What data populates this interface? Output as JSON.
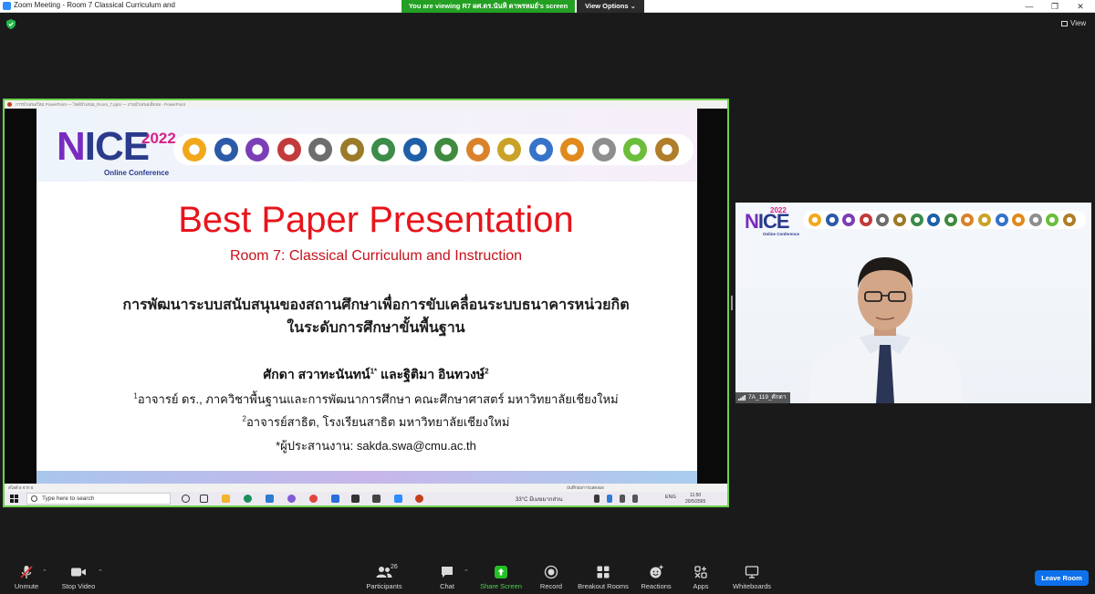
{
  "window": {
    "title": "Zoom Meeting - Room 7 Classical Curriculum and",
    "viewing_banner": "You are viewing R7 ผศ.ดร.นันทิ ตาพรหมย์'s screen",
    "view_options": "View Options ⌄",
    "view_label": "View",
    "minimize": "—",
    "restore": "❐",
    "close": "✕"
  },
  "ppt": {
    "title_bar": "การนำเสนอใหม่ PowerPoint  —  ไฟล์นำเสนอ_Room_7.pptx  —  งานนำเสนอเต็มจอ - PowerPoint",
    "status": "สไลด์ 6 จาก 6",
    "status_right": "บันทึกย่อการแสดงผล"
  },
  "slide": {
    "logo_year": "2022",
    "logo_n": "N",
    "logo_rest": "ICE",
    "logo_sub": "Online Conference",
    "title": "Best Paper Presentation",
    "subtitle": "Room 7: Classical Curriculum and Instruction",
    "thai_title_line1": "การพัฒนาระบบสนับสนุนของสถานศึกษาเพื่อการขับเคลื่อนระบบธนาคารหน่วยกิต",
    "thai_title_line2": "ในระดับการศึกษาขั้นพื้นฐาน",
    "author1": "ศักดา สวาทะนันทน์",
    "author1_sup": "1*",
    "author_join": " และฐิติมา อินทวงษ์",
    "author2_sup": "2",
    "aff1_sup": "1",
    "aff1": "อาจารย์ ดร., ภาควิชาพื้นฐานและการพัฒนาการศึกษา คณะศึกษาศาสตร์ มหาวิทยาลัยเชียงใหม่",
    "aff2_sup": "2",
    "aff2": "อาจารย์สาธิต, โรงเรียนสาธิต มหาวิทยาลัยเชียงใหม่",
    "contact": "*ผู้ประสานงาน: sakda.swa@cmu.ac.th"
  },
  "taskbar": {
    "search_placeholder": "Type here to search",
    "weather": "33°C  มีเมฆมากส่วน",
    "lang": "ENG",
    "time": "11:50",
    "date": "20/5/2565"
  },
  "video": {
    "name_tag": "7A_119_ศักดา"
  },
  "toolbar": {
    "unmute": "Unmute",
    "stop_video": "Stop Video",
    "participants": "Participants",
    "participants_count": "26",
    "chat": "Chat",
    "share_screen": "Share Screen",
    "record": "Record",
    "breakout_rooms": "Breakout Rooms",
    "reactions": "Reactions",
    "apps": "Apps",
    "whiteboards": "Whiteboards",
    "leave_room": "Leave Room"
  },
  "colors": {
    "share_border": "#6fd04c",
    "banner_green": "#23a023",
    "share_screen_green": "#23c023",
    "leave_blue": "#0e71eb",
    "title_red": "#e8141b"
  }
}
